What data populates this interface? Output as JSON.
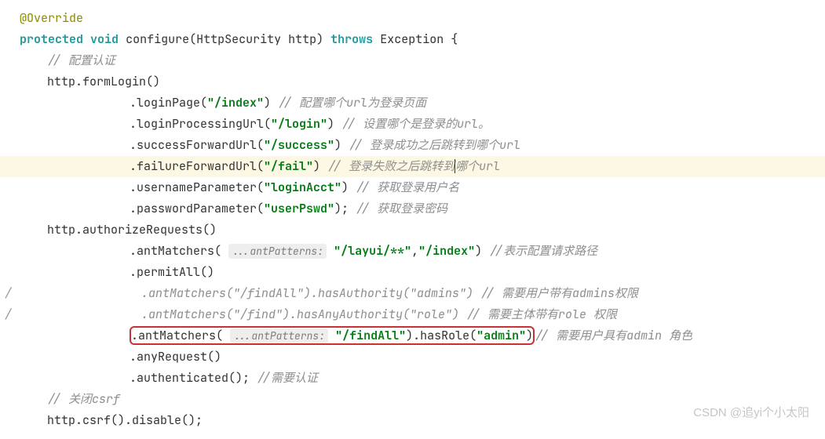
{
  "code": {
    "annotation": "@Override",
    "keywords": {
      "protected": "protected",
      "void": "void",
      "throws": "throws"
    },
    "methodSig": {
      "name": "configure",
      "paramType": "HttpSecurity",
      "paramName": "http",
      "exception": "Exception",
      "openBrace": "{"
    },
    "comments": {
      "configAuth": "// 配置认证",
      "loginPage": "// 配置哪个url为登录页面",
      "loginProcessing": "// 设置哪个是登录的url。",
      "successForward": "// 登录成功之后跳转到哪个url",
      "failureForward": "// 登录失败之后跳转到",
      "failureForwardTail": "哪个url",
      "usernameParam": "// 获取登录用户名",
      "passwordParam": "// 获取登录密码",
      "antPatternsPath": "//表示配置请求路径",
      "needAdmins": "// 需要用户带有admins权限",
      "needRole": "// 需要主体带有role 权限",
      "needAdminRole": "// 需要用户具有admin 角色",
      "needAuth": "//需要认证",
      "closeCsrf": "// 关闭csrf"
    },
    "httpVar": "http",
    "formLogin": ".formLogin()",
    "loginPage": {
      "name": ".loginPage(",
      "arg": "\"/index\"",
      "close": ")"
    },
    "loginProcessingUrl": {
      "name": ".loginProcessingUrl(",
      "arg": "\"/login\"",
      "close": ")"
    },
    "successForwardUrl": {
      "name": ".successForwardUrl(",
      "arg": "\"/success\"",
      "close": ")"
    },
    "failureForwardUrl": {
      "name": ".failureForwardUrl(",
      "arg": "\"/fail\"",
      "close": ")"
    },
    "usernameParameter": {
      "name": ".usernameParameter(",
      "arg": "\"loginAcct\"",
      "close": ")"
    },
    "passwordParameter": {
      "name": ".passwordParameter(",
      "arg": "\"userPswd\"",
      "close": ");"
    },
    "authorizeRequests": ".authorizeRequests()",
    "antMatchers1": {
      "name": ".antMatchers(",
      "hint": "...antPatterns:",
      "arg1": "\"/layui/**\"",
      "comma": ",",
      "arg2": "\"/index\"",
      "close": ")"
    },
    "permitAll": ".permitAll()",
    "commented1": ".antMatchers(\"/findAll\").hasAuthority(\"admins\")",
    "commented2": ".antMatchers(\"/find\").hasAnyAuthority(\"role\")",
    "antMatchers2": {
      "name": ".antMatchers(",
      "hint": "...antPatterns:",
      "arg": "\"/findAll\"",
      "mid": ").hasRole(",
      "roleArg": "\"admin\"",
      "close": ")"
    },
    "anyRequest": ".anyRequest()",
    "authenticated": ".authenticated();",
    "csrf": ".csrf().disable();"
  },
  "watermark": "CSDN @追yi个小太阳",
  "gutterSlash": "/"
}
